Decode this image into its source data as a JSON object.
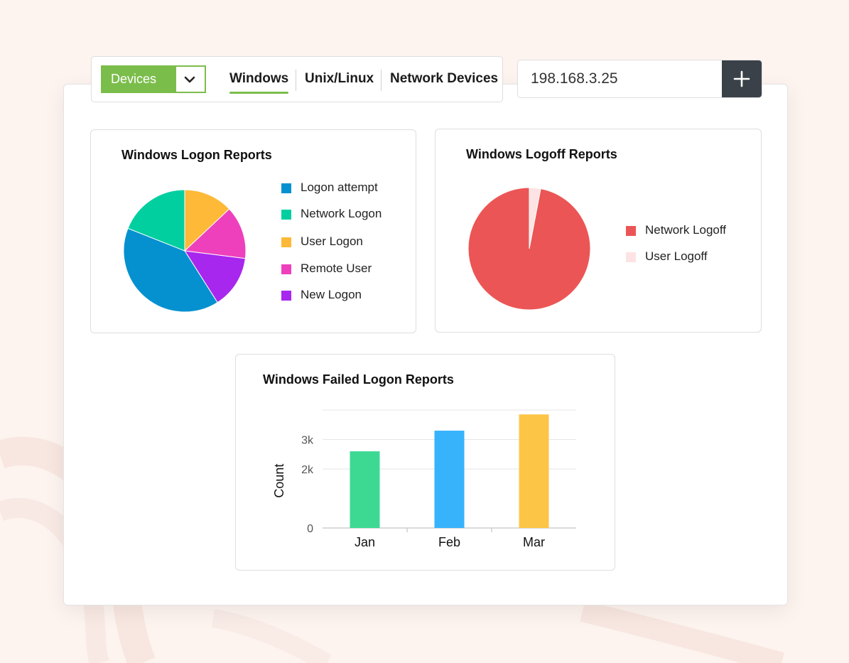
{
  "toolbar": {
    "device_select": {
      "selected": "Devices",
      "icon": "chevron-down-icon"
    },
    "tabs": [
      {
        "label": "Windows",
        "active": true
      },
      {
        "label": "Unix/Linux",
        "active": false
      },
      {
        "label": "Network Devices",
        "active": false
      }
    ],
    "accent_color": "#7bbd4b"
  },
  "ip_field": {
    "value": "198.168.3.25",
    "add_icon": "plus-icon"
  },
  "logon_card": {
    "title": "Windows Logon Reports",
    "chart_data": {
      "type": "pie",
      "title": "Windows Logon Reports",
      "legend_position": "right",
      "slices": [
        {
          "label": "Logon attempt",
          "value": 40,
          "color": "#0591cf"
        },
        {
          "label": "Network Logon",
          "value": 19,
          "color": "#02cfa0"
        },
        {
          "label": "User Logon",
          "value": 13,
          "color": "#fdb937"
        },
        {
          "label": "Remote User",
          "value": 14,
          "color": "#ee40bc"
        },
        {
          "label": "New Logon",
          "value": 14,
          "color": "#a727ee"
        }
      ]
    }
  },
  "logoff_card": {
    "title": "Windows Logoff Reports",
    "chart_data": {
      "type": "pie",
      "title": "Windows Logoff Reports",
      "legend_position": "right",
      "slices": [
        {
          "label": "Network Logoff",
          "value": 97,
          "color": "#ec5555"
        },
        {
          "label": "User Logoff",
          "value": 3,
          "color": "#fde3e3"
        }
      ]
    }
  },
  "failed_card": {
    "title": "Windows Failed Logon Reports",
    "chart_data": {
      "type": "bar",
      "title": "Windows Failed Logon Reports",
      "categories": [
        "Jan",
        "Feb",
        "Mar"
      ],
      "values": [
        2600,
        3300,
        3850
      ],
      "colors": [
        "#3dd993",
        "#36b3fb",
        "#fdc545"
      ],
      "xlabel": "",
      "ylabel": "Count",
      "yticks": [
        {
          "value": 0,
          "label": "0"
        },
        {
          "value": 2000,
          "label": "2k"
        },
        {
          "value": 3000,
          "label": "3k"
        }
      ],
      "ylim": [
        0,
        4000
      ],
      "grid": true
    }
  }
}
